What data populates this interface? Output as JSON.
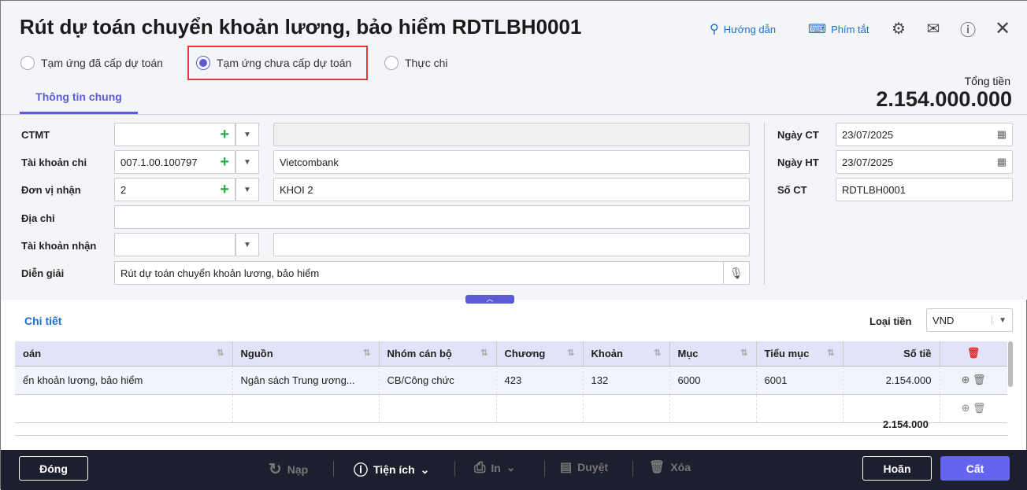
{
  "title": "Rút dự toán chuyển khoản lương, bảo hiểm RDTLBH0001",
  "toolbar": {
    "guide": "Hướng dẫn",
    "shortcuts": "Phím tắt"
  },
  "radios": [
    {
      "label": "Tạm ứng đã cấp dự toán",
      "checked": false
    },
    {
      "label": "Tạm ứng chưa cấp dự toán",
      "checked": true
    },
    {
      "label": "Thực chi",
      "checked": false
    }
  ],
  "tab": "Thông tin chung",
  "total": {
    "label": "Tổng tiền",
    "value": "2.154.000.000"
  },
  "form": {
    "ctmt": {
      "label": "CTMT",
      "value": "",
      "name": ""
    },
    "tk_chi": {
      "label": "Tài khoản chi",
      "value": "007.1.00.100797",
      "name": "Vietcombank"
    },
    "don_vi": {
      "label": "Đơn vị nhận",
      "value": "2",
      "name": "KHOI 2"
    },
    "dia_chi": {
      "label": "Địa chỉ",
      "value": ""
    },
    "tk_nhan": {
      "label": "Tài khoản nhận",
      "value": "",
      "name": ""
    },
    "dien_giai": {
      "label": "Diễn giải",
      "value": "Rút dự toán chuyển khoản lương, bảo hiểm"
    },
    "ngay_ct": {
      "label": "Ngày CT",
      "value": "23/07/2025"
    },
    "ngay_ht": {
      "label": "Ngày HT",
      "value": "23/07/2025"
    },
    "so_ct": {
      "label": "Số CT",
      "value": "RDTLBH0001"
    }
  },
  "detail": {
    "title": "Chi tiết",
    "currency_label": "Loại tiền",
    "currency": "VND",
    "columns": [
      "oán",
      "Nguồn",
      "Nhóm cán bộ",
      "Chương",
      "Khoản",
      "Mục",
      "Tiểu mục",
      "Số tiề"
    ],
    "rows": [
      [
        "ển khoản lương, bảo hiểm",
        "Ngân sách Trung ương...",
        "CB/Công chức",
        "423",
        "132",
        "6000",
        "6001",
        "2.154.000"
      ]
    ],
    "sum": "2.154.000"
  },
  "footer": {
    "close": "Đóng",
    "reload": "Nạp",
    "utilities": "Tiện ích",
    "print": "In",
    "approve": "Duyệt",
    "delete": "Xóa",
    "cancel": "Hoãn",
    "save": "Cất"
  }
}
